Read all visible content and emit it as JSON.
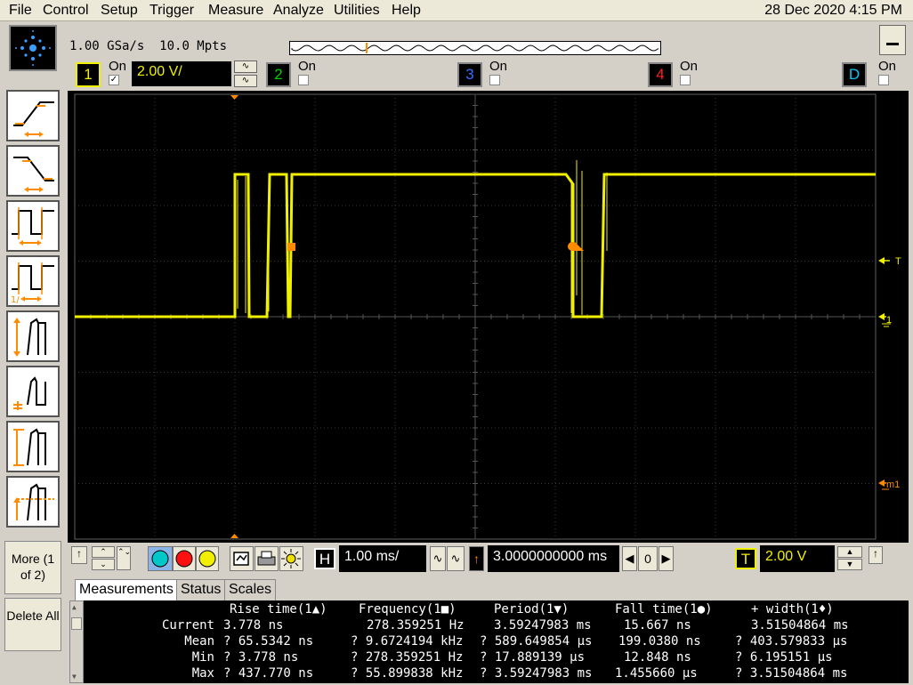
{
  "menu": {
    "items": [
      "File",
      "Control",
      "Setup",
      "Trigger",
      "Measure",
      "Analyze",
      "Utilities",
      "Help"
    ]
  },
  "datetime": "28 Dec 2020  4:15 PM",
  "acquisition": {
    "sample_rate": "1.00 GSa/s",
    "memory_depth": "10.0 Mpts"
  },
  "channels": [
    {
      "number": "1",
      "on_label": "On",
      "enabled": true,
      "scale": "2.00 V/",
      "color": "#f0f000"
    },
    {
      "number": "2",
      "on_label": "On",
      "enabled": false,
      "color": "#00c000"
    },
    {
      "number": "3",
      "on_label": "On",
      "enabled": false,
      "color": "#3070ff"
    },
    {
      "number": "4",
      "on_label": "On",
      "enabled": false,
      "color": "#ff2020"
    },
    {
      "number": "D",
      "on_label": "On",
      "enabled": false,
      "color": "#00c8ff"
    }
  ],
  "side": {
    "more": "More (1 of 2)",
    "delete_all": "Delete All"
  },
  "markers": {
    "trigger": "T",
    "ch1": "1",
    "math": "m1"
  },
  "timebase": {
    "scale": "1.00 ms/",
    "delay": "3.0000000000 ms",
    "delay_digit": "0"
  },
  "trigger": {
    "label": "T",
    "level": "2.00 V"
  },
  "tabs": [
    "Measurements",
    "Status",
    "Scales"
  ],
  "measurements": {
    "headers": [
      "Rise time(1▲)",
      "Frequency(1■)",
      "Period(1▼)",
      "Fall time(1●)",
      "+ width(1♦)"
    ],
    "rows": [
      {
        "label": "Current",
        "values": [
          "3.778 ns",
          "278.359251 Hz",
          "3.59247983 ms",
          "15.667 ns",
          "3.51504864 ms"
        ]
      },
      {
        "label": "Mean",
        "values": [
          "? 65.5342 ns",
          "? 9.6724194 kHz",
          "? 589.649854 μs",
          "199.0380 ns",
          "? 403.579833 μs"
        ]
      },
      {
        "label": "Min",
        "values": [
          "? 3.778 ns",
          "? 278.359251 Hz",
          "? 17.889139 μs",
          "12.848 ns",
          "? 6.195151 μs"
        ]
      },
      {
        "label": "Max",
        "values": [
          "? 437.770 ns",
          "? 55.899838 kHz",
          "? 3.59247983 ms",
          "1.455660 μs",
          "? 3.51504864 ms"
        ]
      }
    ]
  },
  "colors": {
    "trace": "#f0f000",
    "marker": "#ff8c00",
    "grid": "#505050"
  }
}
